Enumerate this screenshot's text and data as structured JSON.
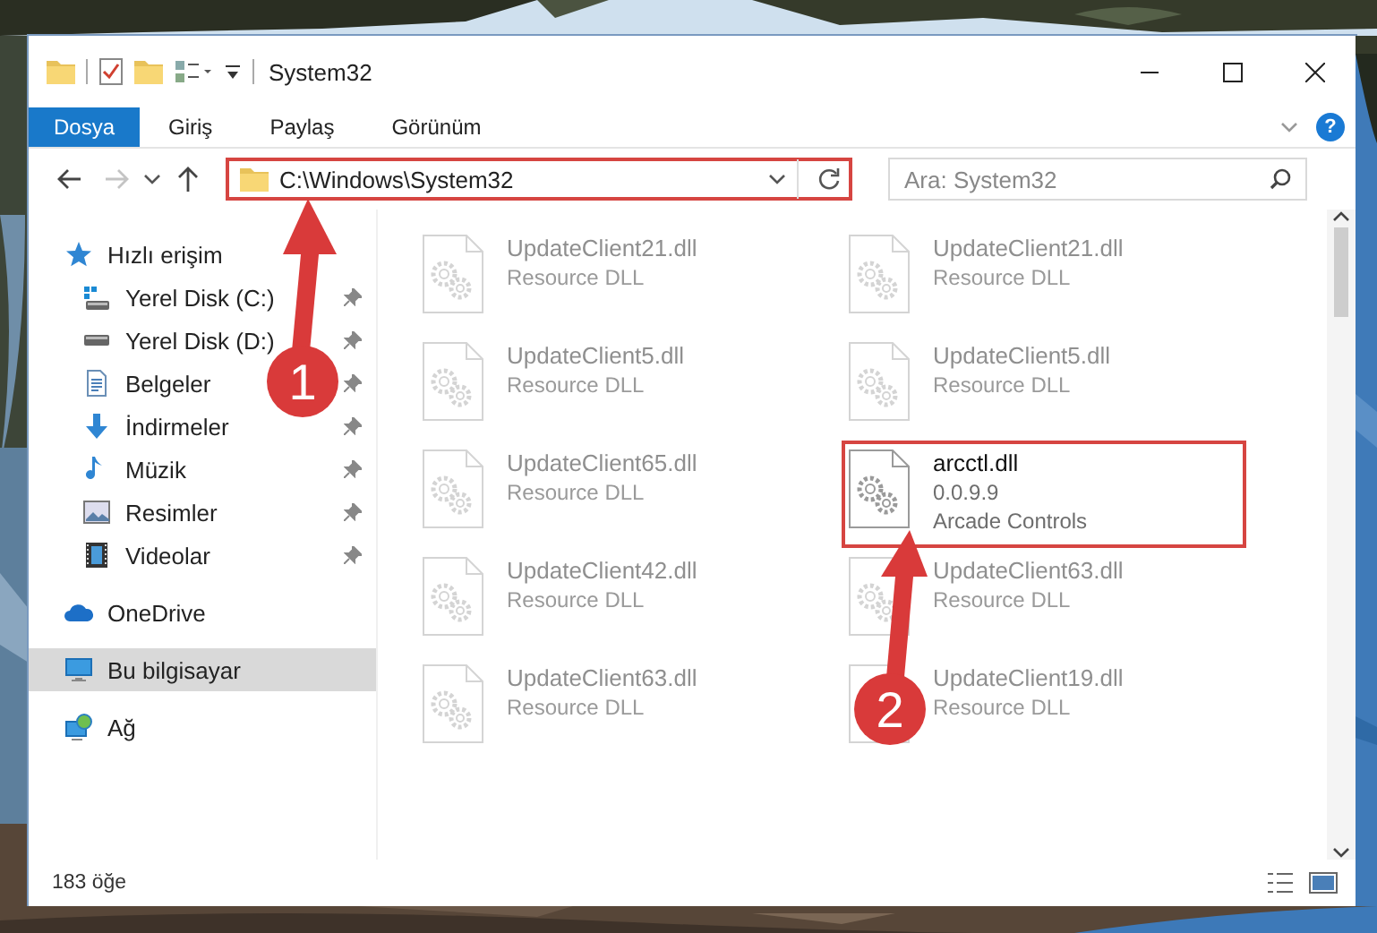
{
  "window": {
    "title": "System32"
  },
  "ribbon": {
    "tabs": [
      {
        "label": "Dosya",
        "selected": true
      },
      {
        "label": "Giriş",
        "selected": false
      },
      {
        "label": "Paylaş",
        "selected": false
      },
      {
        "label": "Görünüm",
        "selected": false
      }
    ],
    "help": "?"
  },
  "address": {
    "path": "C:\\Windows\\System32",
    "highlighted": true
  },
  "search": {
    "placeholder": "Ara: System32"
  },
  "sidebar": {
    "items": [
      {
        "label": "Hızlı erişim",
        "kind": "star",
        "selected": false,
        "children": [
          {
            "label": "Yerel Disk (C:)",
            "kind": "system-drive",
            "pinned": true,
            "selected": false
          },
          {
            "label": "Yerel Disk (D:)",
            "kind": "drive",
            "pinned": true,
            "selected": false
          },
          {
            "label": "Belgeler",
            "kind": "documents",
            "pinned": true,
            "selected": false
          },
          {
            "label": "İndirmeler",
            "kind": "downloads",
            "pinned": true,
            "selected": false
          },
          {
            "label": "Müzik",
            "kind": "music",
            "pinned": true,
            "selected": false
          },
          {
            "label": "Resimler",
            "kind": "pictures",
            "pinned": true,
            "selected": false
          },
          {
            "label": "Videolar",
            "kind": "videos",
            "pinned": true,
            "selected": false
          }
        ]
      },
      {
        "label": "OneDrive",
        "kind": "cloud",
        "selected": false
      },
      {
        "label": "Bu bilgisayar",
        "kind": "computer",
        "selected": true
      },
      {
        "label": "Ağ",
        "kind": "network",
        "selected": false
      }
    ]
  },
  "files": [
    {
      "kind": "dimmed",
      "name": "UpdateClient21.dll",
      "type": "Resource DLL",
      "highlighted": false
    },
    {
      "kind": "dimmed",
      "name": "UpdateClient21.dll",
      "type": "Resource DLL",
      "highlighted": false
    },
    {
      "kind": "dimmed",
      "name": "UpdateClient5.dll",
      "type": "Resource DLL",
      "highlighted": false
    },
    {
      "kind": "dimmed",
      "name": "UpdateClient5.dll",
      "type": "Resource DLL",
      "highlighted": false
    },
    {
      "kind": "dimmed",
      "name": "UpdateClient65.dll",
      "type": "Resource DLL",
      "highlighted": false
    },
    {
      "kind": "detailed",
      "name": "arcctl.dll",
      "version": "0.0.9.9",
      "description": "Arcade Controls",
      "highlighted": true
    },
    {
      "kind": "dimmed",
      "name": "UpdateClient42.dll",
      "type": "Resource DLL",
      "highlighted": false
    },
    {
      "kind": "dimmed",
      "name": "UpdateClient63.dll",
      "type": "Resource DLL",
      "highlighted": false
    },
    {
      "kind": "dimmed",
      "name": "UpdateClient63.dll",
      "type": "Resource DLL",
      "highlighted": false
    },
    {
      "kind": "dimmed",
      "name": "UpdateClient19.dll",
      "type": "Resource DLL",
      "highlighted": false
    }
  ],
  "status_bar": {
    "count": "183 öğe"
  },
  "annotations": [
    {
      "label": "1"
    },
    {
      "label": "2"
    }
  ]
}
